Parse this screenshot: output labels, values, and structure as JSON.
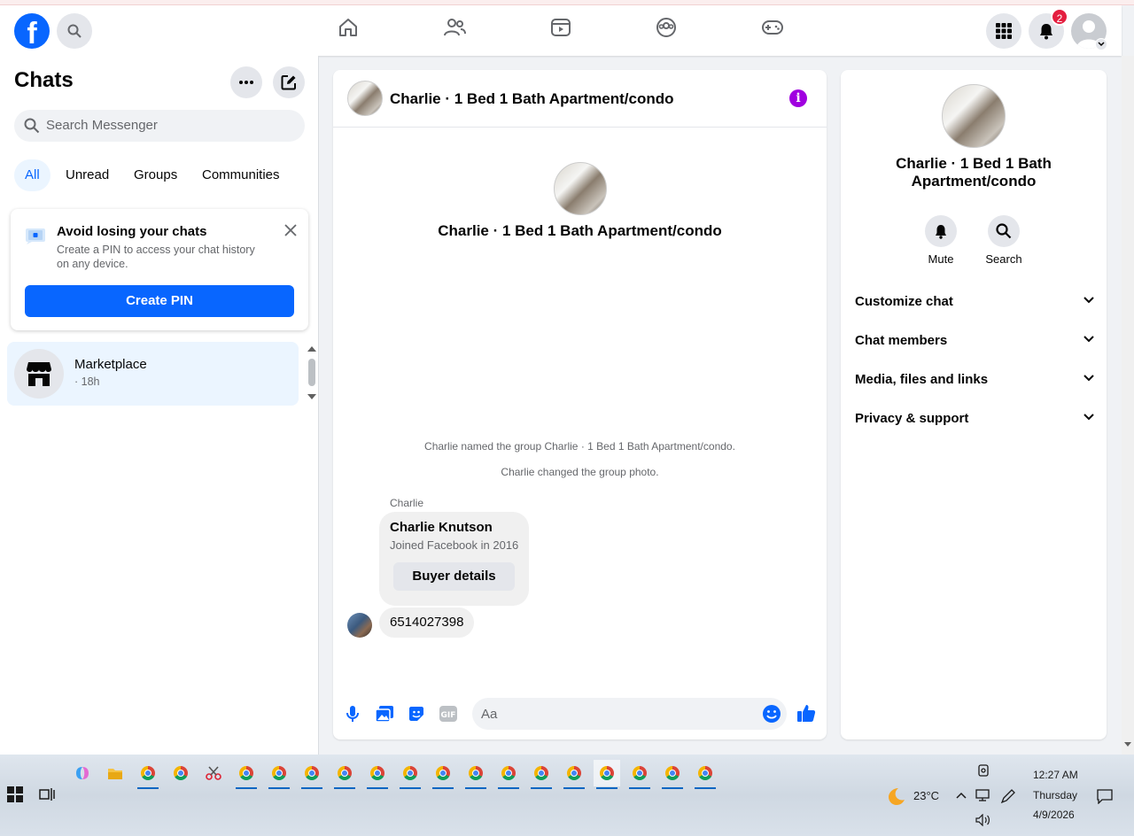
{
  "topnav": {
    "logo": "f",
    "notifications_badge": "2",
    "icons": [
      "search-icon",
      "home-icon",
      "friends-icon",
      "watch-icon",
      "groups-icon",
      "gaming-icon",
      "menu-grid-icon",
      "bell-icon",
      "profile-avatar"
    ]
  },
  "sidebar": {
    "title": "Chats",
    "search_placeholder": "Search Messenger",
    "filters": [
      {
        "label": "All",
        "active": true
      },
      {
        "label": "Unread",
        "active": false
      },
      {
        "label": "Groups",
        "active": false
      },
      {
        "label": "Communities",
        "active": false
      }
    ],
    "pin_card": {
      "title": "Avoid losing your chats",
      "description": "Create a PIN to access your chat history on any device.",
      "button": "Create PIN"
    },
    "chats": [
      {
        "name": "Marketplace",
        "time": "· 18h",
        "selected": true
      }
    ]
  },
  "conversation": {
    "title": "Charlie · 1 Bed 1 Bath Apartment/condo",
    "system_messages": [
      "Charlie named the group Charlie · 1 Bed 1 Bath Apartment/condo.",
      "Charlie changed the group photo."
    ],
    "sender": "Charlie",
    "profile_card": {
      "name": "Charlie Knutson",
      "subtitle": "Joined Facebook in 2016",
      "button": "Buyer details"
    },
    "message": "6514027398",
    "composer_placeholder": "Aa"
  },
  "details_panel": {
    "title": "Charlie · 1 Bed 1 Bath Apartment/condo",
    "actions": [
      {
        "label": "Mute",
        "icon": "bell-icon"
      },
      {
        "label": "Search",
        "icon": "search-icon"
      }
    ],
    "sections": [
      "Customize chat",
      "Chat members",
      "Media, files and links",
      "Privacy & support"
    ]
  },
  "taskbar": {
    "weather": "23°C",
    "time": "12:27 AM",
    "day": "Thursday",
    "date": "4/9/2026"
  },
  "colors": {
    "accent": "#0866ff",
    "info": "#a000e0",
    "badge": "#e41e3f"
  }
}
